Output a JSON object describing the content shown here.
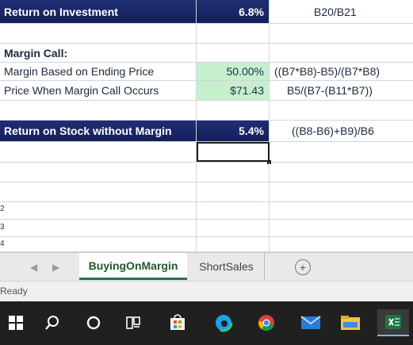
{
  "sheet": {
    "roi": {
      "label": "Return on Investment",
      "value": "6.8%",
      "formula": "B20/B21"
    },
    "margin_call": {
      "heading": "Margin Call:",
      "ending_price": {
        "label": "Margin Based on Ending Price",
        "value": "50.00%",
        "formula": "((B7*B8)-B5)/(B7*B8)"
      },
      "call_price": {
        "label": "Price When Margin Call Occurs",
        "value": "$71.43",
        "formula": "B5/(B7-(B11*B7))"
      }
    },
    "no_margin": {
      "label": "Return on Stock without Margin",
      "value": "5.4%",
      "formula": "((B8-B6)+B9)/B6"
    },
    "row_numbers": [
      "2",
      "3",
      "4"
    ]
  },
  "tabs": {
    "active": "BuyingOnMargin",
    "inactive": "ShortSales",
    "add_symbol": "+",
    "prev_arrow": "◀",
    "next_arrow": "▶"
  },
  "status": {
    "text": "Ready"
  },
  "taskbar": {
    "icons": [
      "windows-start",
      "search",
      "cortana",
      "task-view",
      "store",
      "edge",
      "chrome",
      "mail",
      "file-explorer",
      "excel"
    ]
  },
  "colors": {
    "header_navy": "#1f2f73",
    "green_fill": "#c6efce",
    "excel_green": "#217346"
  }
}
